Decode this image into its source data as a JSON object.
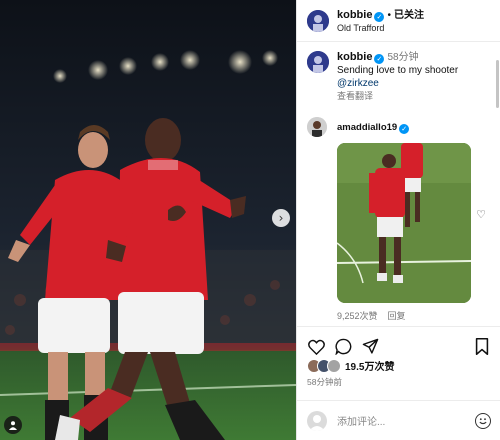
{
  "post": {
    "username": "kobbie",
    "follow_status": "已关注",
    "location": "Old Trafford"
  },
  "caption": {
    "username": "kobbie",
    "time": "58分钟",
    "text": "Sending love to my shooter",
    "mention": "@zirkzee",
    "translate": "查看翻译"
  },
  "comment": {
    "username": "amaddiallo19",
    "likes": "9,252次赞",
    "reply": "回复"
  },
  "footer": {
    "likes": "19.5万次赞",
    "time_ago": "58分钟前",
    "comment_placeholder": "添加评论..."
  },
  "icons": {
    "verified": "verified-badge-icon",
    "heart": "heart-icon",
    "comment": "comment-icon",
    "share": "share-icon",
    "bookmark": "bookmark-icon",
    "next": "chevron-right-icon",
    "emoji": "emoji-icon",
    "user_tag": "user-tag-icon"
  },
  "colors": {
    "verified": "#0095f6",
    "mention": "#00376b",
    "muted": "#777777"
  }
}
